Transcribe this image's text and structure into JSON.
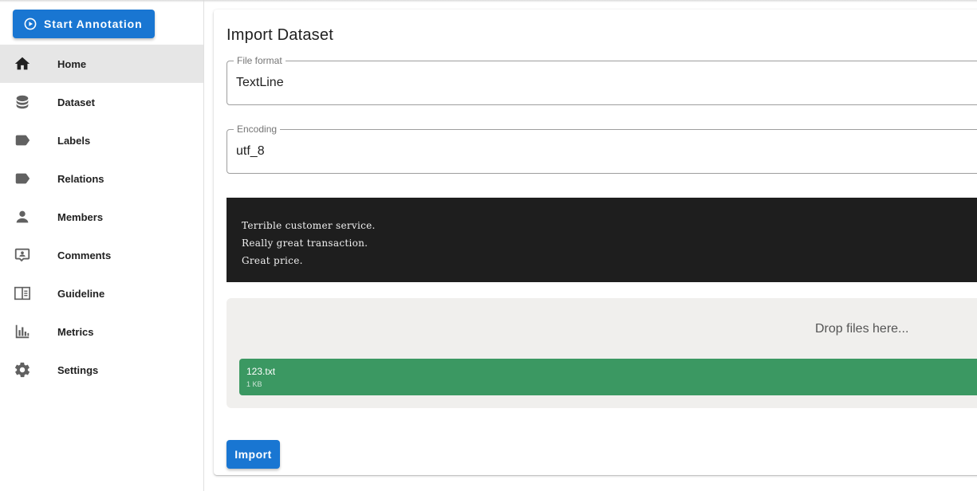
{
  "sidebar": {
    "start_button": {
      "label": "Start Annotation",
      "icon": "play-circle-icon"
    },
    "items": [
      {
        "label": "Home",
        "icon": "home-icon",
        "active": true
      },
      {
        "label": "Dataset",
        "icon": "database-icon"
      },
      {
        "label": "Labels",
        "icon": "label-icon"
      },
      {
        "label": "Relations",
        "icon": "label-icon"
      },
      {
        "label": "Members",
        "icon": "account-icon"
      },
      {
        "label": "Comments",
        "icon": "comment-account-icon"
      },
      {
        "label": "Guideline",
        "icon": "book-open-icon"
      },
      {
        "label": "Metrics",
        "icon": "chart-bar-icon"
      },
      {
        "label": "Settings",
        "icon": "gear-icon"
      }
    ]
  },
  "main": {
    "title": "Import Dataset",
    "file_format": {
      "label": "File format",
      "value": "TextLine"
    },
    "encoding": {
      "label": "Encoding",
      "value": "utf_8"
    },
    "example_lines": [
      "Terrible customer service.",
      "Really great transaction.",
      "Great price."
    ],
    "dropzone": {
      "message": "Drop files here...",
      "file": {
        "name": "123.txt",
        "size": "1 KB"
      }
    },
    "import_button": "Import"
  },
  "colors": {
    "primary": "#1976d2",
    "file_item": "#3b9862",
    "code_bg": "#1e1e1e",
    "active_nav": "#e6e6e6"
  }
}
